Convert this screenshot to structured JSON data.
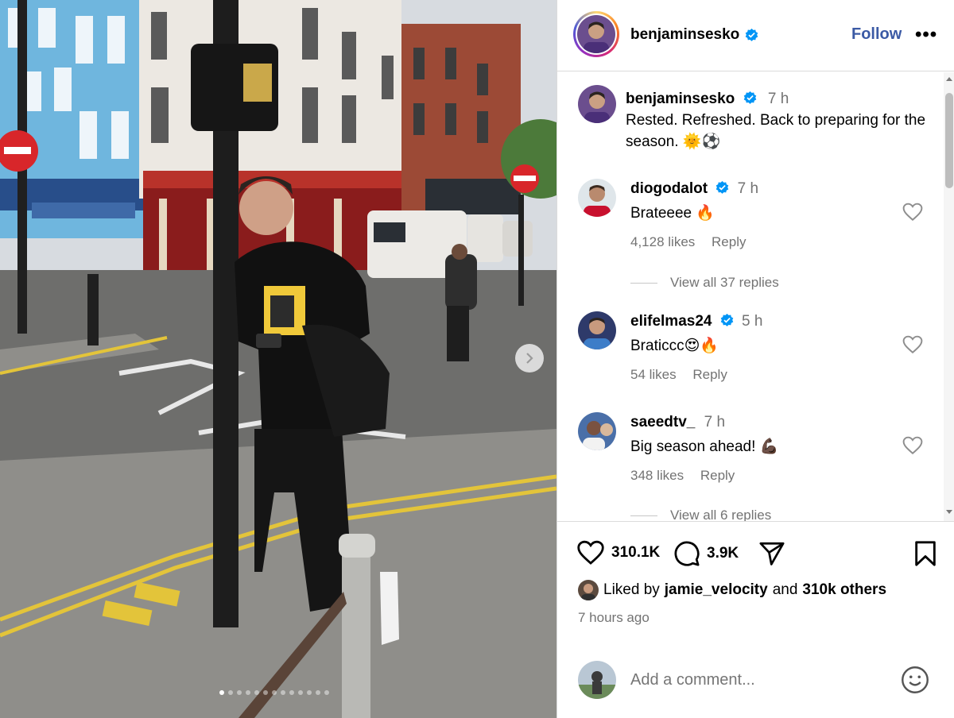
{
  "post": {
    "username": "benjaminsesko",
    "follow_label": "Follow",
    "more_label": "•••",
    "caption_time": "7 h",
    "caption_text": "Rested. Refreshed. Back to preparing for the season. 🌞⚽",
    "image_count": 13,
    "active_image": 1
  },
  "comments": [
    {
      "username": "diogodalot",
      "verified": true,
      "time": "7 h",
      "text": "Brateeee 🔥",
      "likes": "4,128 likes",
      "reply": "Reply",
      "view_replies": "View all 37 replies"
    },
    {
      "username": "elifelmas24",
      "verified": true,
      "time": "5 h",
      "text": "Braticcc😍🔥",
      "likes": "54 likes",
      "reply": "Reply",
      "view_replies": ""
    },
    {
      "username": "saeedtv_",
      "verified": false,
      "time": "7 h",
      "text": "Big season ahead! 💪🏿",
      "likes": "348 likes",
      "reply": "Reply",
      "view_replies": "View all 6 replies"
    }
  ],
  "actions": {
    "like_count": "310.1K",
    "comment_count": "3.9K"
  },
  "liked_by": {
    "prefix": "Liked by",
    "user": "jamie_velocity",
    "and": "and",
    "others": "310k others"
  },
  "posted_ago": "7 hours ago",
  "add_comment_placeholder": "Add a comment...",
  "colors": {
    "follow": "#3b5aa5",
    "verified": "#0095f6",
    "muted": "#737373",
    "divider": "#dbdbdb"
  },
  "icons": [
    "chevron-right-icon",
    "more-icon",
    "verified-icon",
    "heart-icon",
    "comment-icon",
    "share-icon",
    "bookmark-icon",
    "emoji-icon"
  ]
}
